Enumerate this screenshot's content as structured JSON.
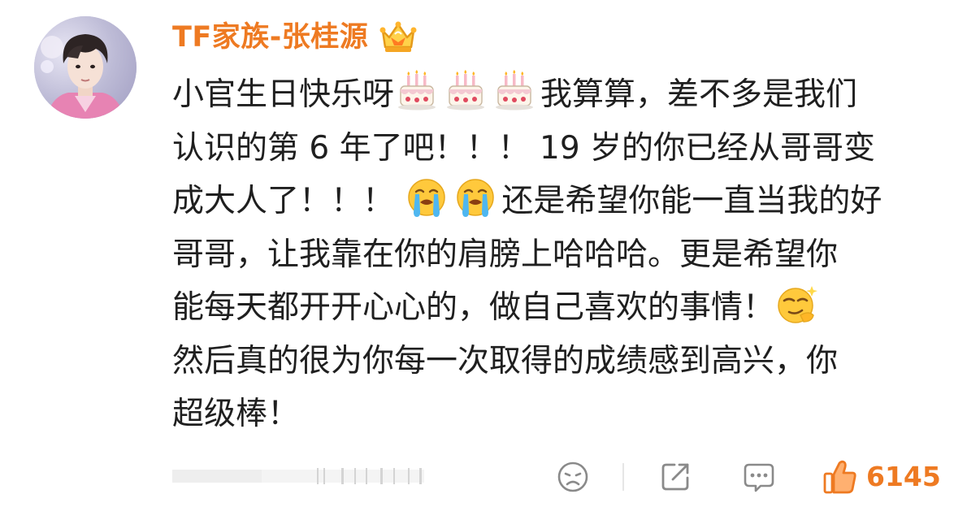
{
  "comment": {
    "username": "TF家族-张桂源",
    "badge_icon": "crown-badge-icon",
    "lines": [
      {
        "parts": [
          {
            "t": "text",
            "v": "小官生日快乐呀"
          },
          {
            "t": "emoji",
            "v": "cake-emoji"
          },
          {
            "t": "emoji",
            "v": "cake-emoji"
          },
          {
            "t": "emoji",
            "v": "cake-emoji"
          },
          {
            "t": "text",
            "v": "我算算，差不多是我们"
          }
        ]
      },
      {
        "parts": [
          {
            "t": "text",
            "v": "认识的第 6 年了吧！！！ 19 岁的你已经从哥哥变"
          }
        ]
      },
      {
        "parts": [
          {
            "t": "text",
            "v": "成大人了！！！ "
          },
          {
            "t": "emoji",
            "v": "crying-emoji"
          },
          {
            "t": "emoji",
            "v": "crying-emoji"
          },
          {
            "t": "text",
            "v": "还是希望你能一直当我的好"
          }
        ]
      },
      {
        "parts": [
          {
            "t": "text",
            "v": "哥哥，让我靠在你的肩膀上哈哈哈。更是希望你"
          }
        ]
      },
      {
        "parts": [
          {
            "t": "text",
            "v": "能每天都开开心心的，做自己喜欢的事情！"
          },
          {
            "t": "emoji",
            "v": "smug-emoji"
          }
        ]
      },
      {
        "parts": [
          {
            "t": "text",
            "v": "然后真的很为你每一次取得的成绩感到高兴，你"
          }
        ]
      },
      {
        "parts": [
          {
            "t": "text",
            "v": "超级棒！"
          }
        ]
      }
    ]
  },
  "actions": {
    "reaction_icon": "sad-face-icon",
    "share_icon": "share-icon",
    "reply_icon": "comment-bubble-icon",
    "like_icon": "thumbs-up-icon",
    "like_count": "6145"
  },
  "colors": {
    "accent": "#ee7a22",
    "text": "#1f1f1f",
    "icon_gray": "#8a8a8a"
  }
}
